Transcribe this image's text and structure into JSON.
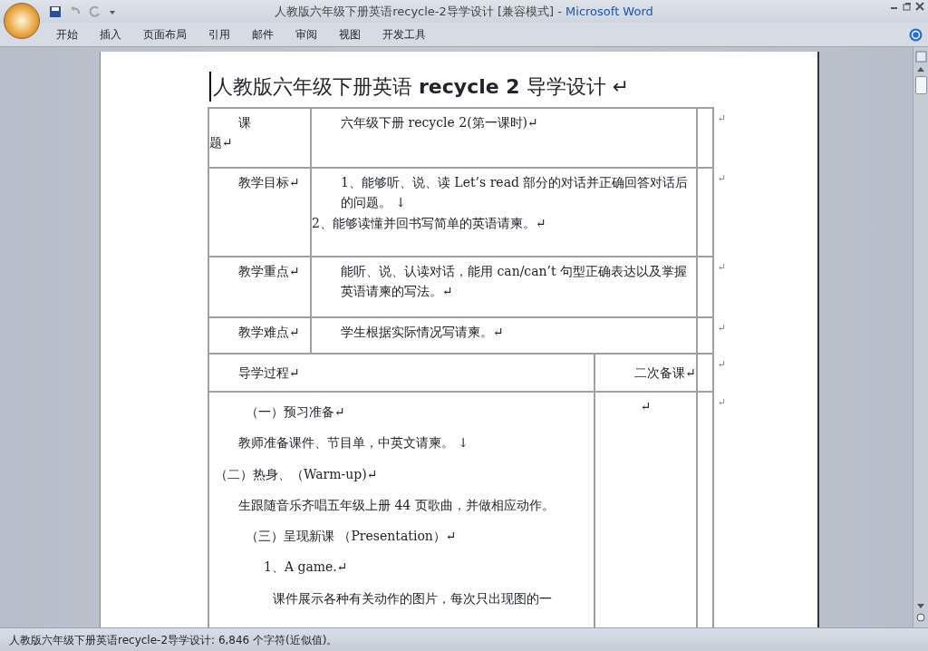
{
  "window": {
    "title_document": "人教版六年级下册英语recycle-2导学设计 [兼容模式]",
    "title_separator": "-",
    "title_app": "Microsoft Word"
  },
  "ribbon_tabs": [
    "开始",
    "插入",
    "页面布局",
    "引用",
    "邮件",
    "审阅",
    "视图",
    "开发工具"
  ],
  "document": {
    "heading": "人教版六年级下册英语 **recycle 2** 导学设计 ↵",
    "rows": [
      {
        "kind": "label",
        "label": [
          "课",
          "题↵"
        ],
        "content": [
          "六年级下册 recycle 2(第一课时)↵"
        ],
        "end_mark": "↵"
      },
      {
        "kind": "label",
        "label": [
          "教学目标↵"
        ],
        "content": [
          "1、能够听、说、读 Let’s  read 部分的对话并正确回答对话后的问题。 ↓",
          "2、能够读懂并回书写简单的英语请柬。↵"
        ],
        "end_mark": "↵"
      },
      {
        "kind": "label",
        "label": [
          "教学重点↵"
        ],
        "content": [
          "能听、说、认读对话，能用 can/can’t 句型正确表达以及掌握英语请柬的写法。↵"
        ],
        "end_mark": "↵"
      },
      {
        "kind": "label",
        "label": [
          "教学难点↵"
        ],
        "content": [
          "学生根据实际情况写请柬。↵"
        ],
        "end_mark": "↵"
      },
      {
        "kind": "header",
        "label": [
          "导学过程↵"
        ],
        "content": [
          "二次备课↵"
        ],
        "end_mark": "↵"
      },
      {
        "kind": "process",
        "label": [
          "（一）预习准备↵",
          "教师准备课件、节目单，中英文请柬。 ↓",
          "（二）热身、（Warm-up)↵",
          "生跟随音乐齐唱五年级上册 44 页歌曲，并做相应动作。",
          "（三）呈现新课 （Presentation）↵",
          "1、A game.↵",
          "课件展示各种有关动作的图片，每次只出现图的一"
        ],
        "content": [
          "↵"
        ],
        "end_mark": "↵"
      }
    ]
  },
  "status_bar": "人教版六年级下册英语recycle-2导学设计: 6,846 个字符(近似值)。"
}
